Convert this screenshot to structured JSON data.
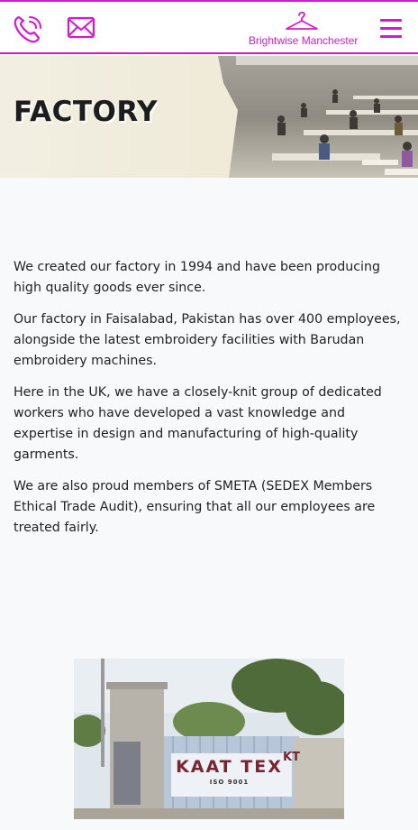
{
  "header": {
    "brand": "Brightwise Manchester",
    "icons": {
      "phone": "phone-icon",
      "mail": "mail-icon",
      "logo": "hanger-icon",
      "menu": "hamburger-menu-icon"
    },
    "accent_color": "#d41ad0"
  },
  "hero": {
    "title": "FACTORY"
  },
  "content": {
    "paragraphs": [
      "We created our factory in 1994 and have been producing high quality goods ever since.",
      "Our factory in Faisalabad, Pakistan has over 400 employees, alongside the latest embroidery facilities with Barudan embroidery machines.",
      "Here in the UK, we have a closely-knit group of dedicated workers who have developed a vast knowledge and expertise in design and manufacturing of high-quality garments.",
      "We are also proud members of SMETA (SEDEX Members Ethical Trade Audit), ensuring that all our employees are treated fairly."
    ]
  },
  "factory_image": {
    "sign_text": "KAAT TEX",
    "sign_sub": "ISO 9001",
    "logo_text": "KT"
  }
}
